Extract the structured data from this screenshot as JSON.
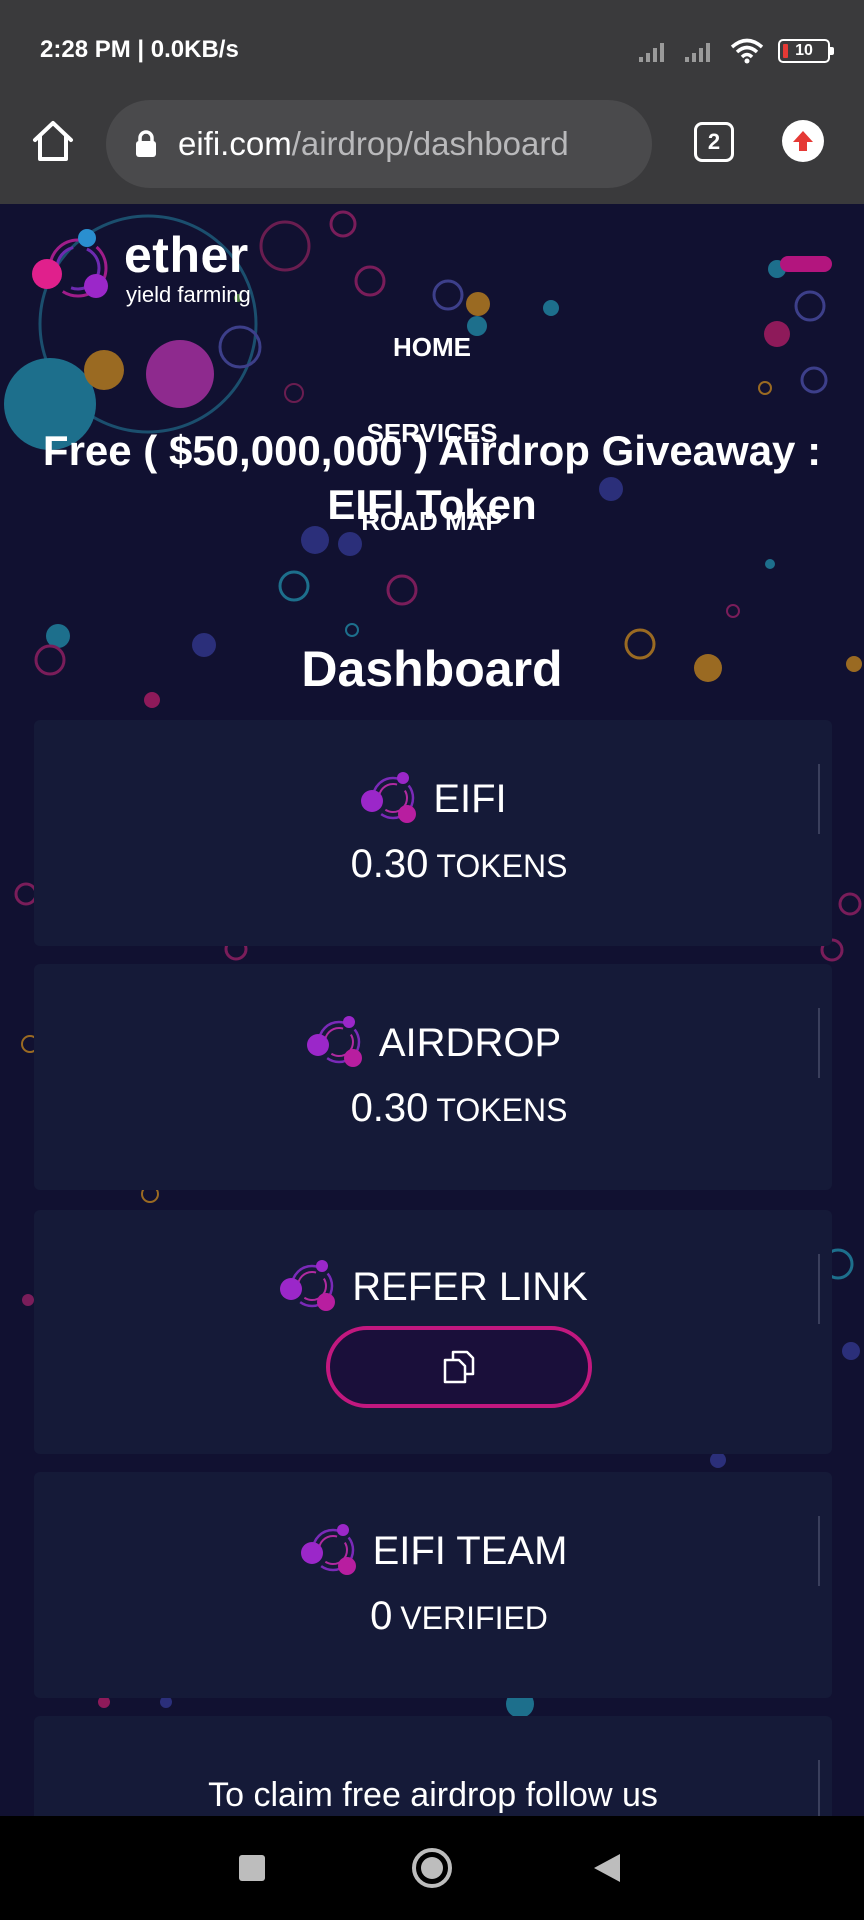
{
  "status_bar": {
    "time": "2:28 PM | 0.0KB/s",
    "battery": "10",
    "icons": [
      "signal-icon",
      "signal-icon",
      "wifi-icon",
      "battery-icon"
    ]
  },
  "browser": {
    "url_domain": "eifi.com",
    "url_path": "/airdrop/dashboard",
    "tab_count": "2",
    "icons": [
      "home-icon",
      "lock-icon",
      "tabs-icon",
      "update-icon"
    ]
  },
  "logo": {
    "word": "ether",
    "sub": "yield farming"
  },
  "nav": {
    "home": "HOME",
    "services": "SERVICES",
    "road_map": "ROAD MAP"
  },
  "hero": {
    "title": "Free ( $50,000,000 ) Airdrop Giveaway : EIFI Token"
  },
  "dashboard": {
    "title": "Dashboard",
    "cards": [
      {
        "label": "EIFI",
        "value": "0.30",
        "unit": "TOKENS"
      },
      {
        "label": "AIRDROP",
        "value": "0.30",
        "unit": "TOKENS"
      },
      {
        "label": "REFER LINK"
      },
      {
        "label": "EIFI TEAM",
        "value": "0",
        "unit": "VERIFIED"
      }
    ],
    "follow_text": "To claim free airdrop follow us"
  },
  "colors": {
    "page_bg": "#111131",
    "card_bg": "#151a38",
    "accent_magenta": "#c2187f",
    "accent_purple": "#9b27c9",
    "chrome_bg": "#3a3a3c"
  }
}
